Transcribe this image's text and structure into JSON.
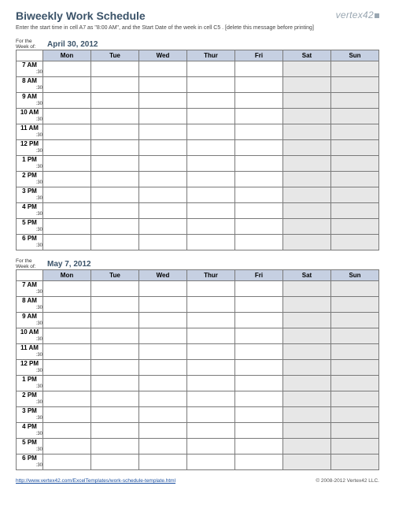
{
  "header": {
    "title": "Biweekly Work Schedule",
    "logo": "vertex42",
    "subtitle": "Enter the start time in cell A7 as \"8:00 AM\", and the Start Date of the week in cell C5 . [delete this message before printing]"
  },
  "weekLabel": "For the\nWeek of:",
  "halfLabel": ":30",
  "days": [
    "Mon",
    "Tue",
    "Wed",
    "Thur",
    "Fri",
    "Sat",
    "Sun"
  ],
  "times": [
    "7 AM",
    "8 AM",
    "9 AM",
    "10 AM",
    "11 AM",
    "12 PM",
    "1 PM",
    "2 PM",
    "3 PM",
    "4 PM",
    "5 PM",
    "6 PM"
  ],
  "weeks": [
    {
      "date": "April 30, 2012"
    },
    {
      "date": "May 7, 2012"
    }
  ],
  "footer": {
    "link": "http://www.vertex42.com/ExcelTemplates/work-schedule-template.html",
    "copyright": "© 2008-2012 Vertex42 LLC."
  }
}
